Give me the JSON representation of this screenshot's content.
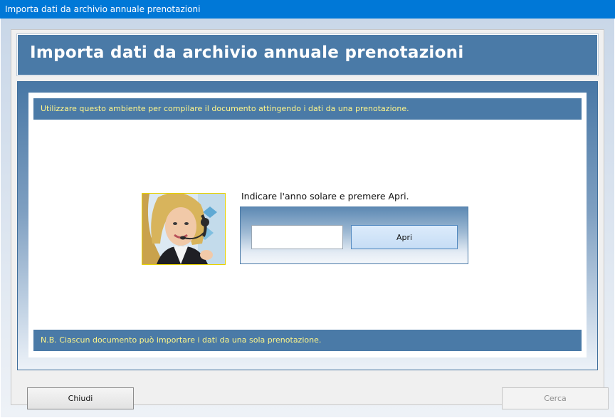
{
  "window": {
    "title": "Importa dati da archivio annuale prenotazioni"
  },
  "header": {
    "title": "Importa dati da archivio annuale prenotazioni"
  },
  "info": {
    "top": "Utilizzare questo ambiente per compilare il documento attingendo i dati da una prenotazione.",
    "bottom": "N.B. Ciascun documento può importare i dati da una sola prenotazione."
  },
  "form": {
    "instruction": "Indicare l'anno solare e premere Apri.",
    "year_value": "",
    "open_label": "Apri"
  },
  "buttons": {
    "close_label": "Chiudi",
    "search_label": "Cerca"
  },
  "colors": {
    "titlebar": "#0078d7",
    "band": "#4a7aa7",
    "info_text": "#fff68a"
  }
}
